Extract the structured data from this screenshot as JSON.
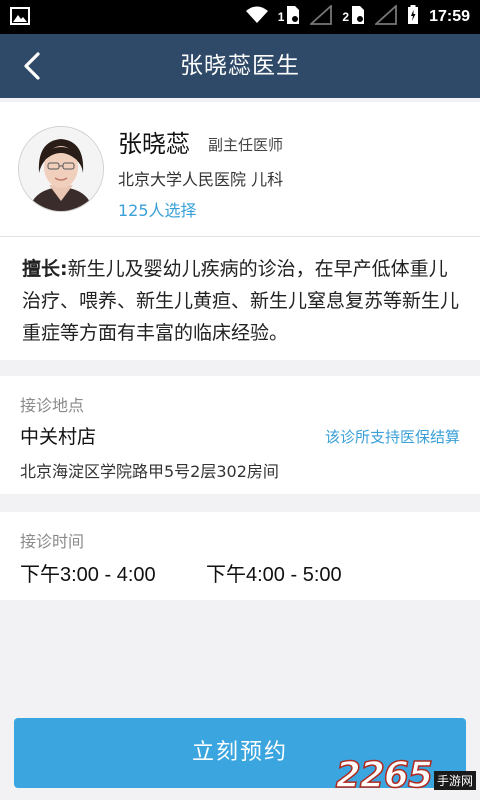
{
  "status_bar": {
    "sim1": "1",
    "sim2": "2",
    "time": "17:59"
  },
  "navbar": {
    "title": "张晓蕊医生"
  },
  "doctor": {
    "name": "张晓蕊",
    "title": "副主任医师",
    "hospital": "北京大学人民医院 儿科",
    "selection_count": "125人选择",
    "intro_label": "擅长:",
    "intro_text": "新生儿及婴幼儿疾病的诊治，在早产低体重儿治疗、喂养、新生儿黄疸、新生儿窒息复苏等新生儿重症等方面有丰富的临床经验。"
  },
  "location": {
    "label": "接诊地点",
    "name": "中关村店",
    "insurance_note": "该诊所支持医保结算",
    "address": "北京海淀区学院路甲5号2层302房间"
  },
  "schedule": {
    "label": "接诊时间",
    "slots": [
      "下午3:00 - 4:00",
      "下午4:00 - 5:00"
    ]
  },
  "actions": {
    "book_label": "立刻预约"
  },
  "watermark": {
    "number": "2265",
    "site": "手游网"
  },
  "colors": {
    "navbar": "#2f4a68",
    "accent": "#3aa0d8",
    "button": "#3aa5df",
    "background": "#f2f2f4"
  }
}
